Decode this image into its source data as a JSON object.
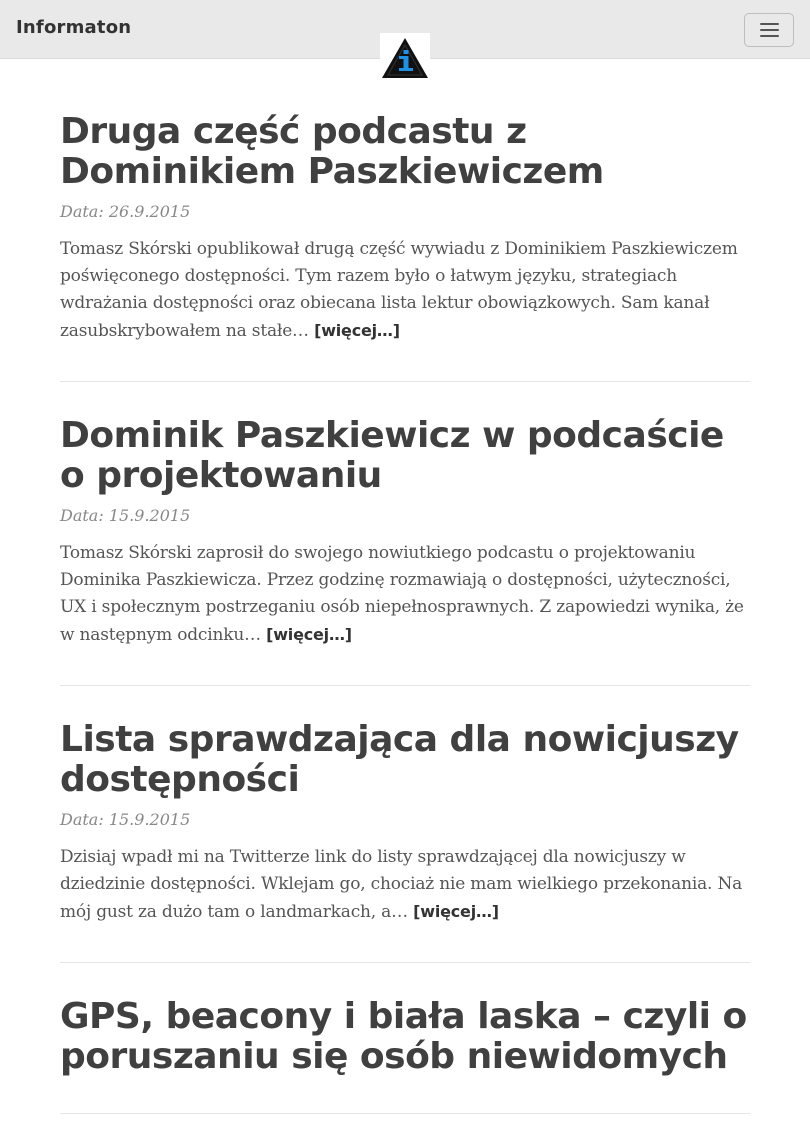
{
  "navbar": {
    "brand": "Informaton",
    "menu_icon": "hamburger-menu-icon",
    "logo_icon": "info-triangle-logo-icon",
    "colors": {
      "background": "#e9e9e9",
      "logo_accent": "#1e90e6"
    }
  },
  "posts": [
    {
      "title": "Druga część podcastu z Dominikiem Paszkiewiczem",
      "date": "Data: 26.9.2015",
      "excerpt": "Tomasz Skórski opublikował drugą część wywiadu z Dominikiem Paszkiewiczem poświęconego dostępności. Tym razem było o łatwym języku, strategiach wdrażania dostępności oraz obiecana lista lektur obowiązkowych. Sam kanał zasubskrybowałem na stałe…",
      "more": "[więcej…]"
    },
    {
      "title": "Dominik Paszkiewicz w podcaście o projektowaniu",
      "date": "Data: 15.9.2015",
      "excerpt": "Tomasz Skórski zaprosił do swojego nowiutkiego podcastu o projektowaniu Dominika Paszkiewicza. Przez godzinę rozmawiają o dostępności, użyteczności, UX i społecznym postrzeganiu osób niepełnosprawnych. Z zapowiedzi wynika, że w następnym odcinku…",
      "more": "[więcej…]"
    },
    {
      "title": "Lista sprawdzająca dla nowicjuszy dostępności",
      "date": "Data: 15.9.2015",
      "excerpt": "Dzisiaj wpadł mi na Twitterze link do listy sprawdzającej dla nowicjuszy w dziedzinie dostępności. Wklejam go, chociaż nie mam wielkiego przekonania. Na mój gust za dużo tam o landmarkach, a…",
      "more": "[więcej…]"
    },
    {
      "title": "GPS, beacony i biała laska – czyli o poruszaniu się osób niewidomych",
      "date": "",
      "excerpt": "",
      "more": ""
    }
  ]
}
